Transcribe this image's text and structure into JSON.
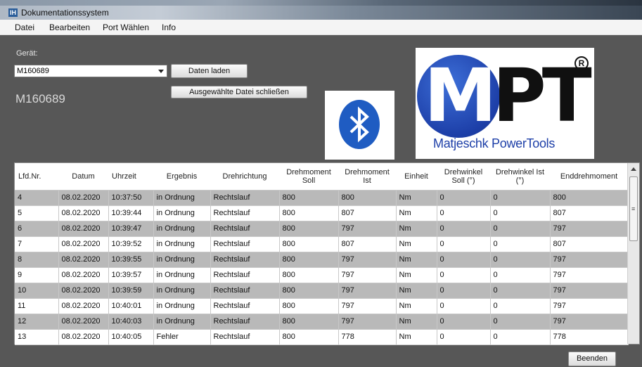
{
  "window": {
    "title": "Dokumentationssystem",
    "icon_text": "IH"
  },
  "menu": [
    "Datei",
    "Bearbeiten",
    "Port Wählen",
    "Info"
  ],
  "device": {
    "label": "Gerät:",
    "selected": "M160689",
    "display": "M160689"
  },
  "buttons": {
    "load": "Daten laden",
    "close_file": "Ausgewählte Datei schließen",
    "quit": "Beenden"
  },
  "logo": {
    "letters_m": "M",
    "letters_rest": "PT",
    "reg": "R",
    "subtitle": "Matjeschk PowerTools"
  },
  "icons": {
    "bluetooth": "bluetooth-icon"
  },
  "colors": {
    "background": "#575757",
    "row_shade": "#b9b9b9",
    "bluetooth": "#1f5cc2"
  },
  "table": {
    "headers": [
      "Lfd.Nr.",
      "Datum",
      "Uhrzeit",
      "Ergebnis",
      "Drehrichtung",
      "Drehmoment\nSoll",
      "Drehmoment\nIst",
      "Einheit",
      "Drehwinkel\nSoll (°)",
      "Drehwinkel Ist\n(°)",
      "Enddrehmoment"
    ],
    "rows": [
      [
        "4",
        "08.02.2020",
        "10:37:50",
        "in Ordnung",
        "Rechtslauf",
        "800",
        "800",
        "Nm",
        "0",
        "0",
        "800"
      ],
      [
        "5",
        "08.02.2020",
        "10:39:44",
        "in Ordnung",
        "Rechtslauf",
        "800",
        "807",
        "Nm",
        "0",
        "0",
        "807"
      ],
      [
        "6",
        "08.02.2020",
        "10:39:47",
        "in Ordnung",
        "Rechtslauf",
        "800",
        "797",
        "Nm",
        "0",
        "0",
        "797"
      ],
      [
        "7",
        "08.02.2020",
        "10:39:52",
        "in Ordnung",
        "Rechtslauf",
        "800",
        "807",
        "Nm",
        "0",
        "0",
        "807"
      ],
      [
        "8",
        "08.02.2020",
        "10:39:55",
        "in Ordnung",
        "Rechtslauf",
        "800",
        "797",
        "Nm",
        "0",
        "0",
        "797"
      ],
      [
        "9",
        "08.02.2020",
        "10:39:57",
        "in Ordnung",
        "Rechtslauf",
        "800",
        "797",
        "Nm",
        "0",
        "0",
        "797"
      ],
      [
        "10",
        "08.02.2020",
        "10:39:59",
        "in Ordnung",
        "Rechtslauf",
        "800",
        "797",
        "Nm",
        "0",
        "0",
        "797"
      ],
      [
        "11",
        "08.02.2020",
        "10:40:01",
        "in Ordnung",
        "Rechtslauf",
        "800",
        "797",
        "Nm",
        "0",
        "0",
        "797"
      ],
      [
        "12",
        "08.02.2020",
        "10:40:03",
        "in Ordnung",
        "Rechtslauf",
        "800",
        "797",
        "Nm",
        "0",
        "0",
        "797"
      ],
      [
        "13",
        "08.02.2020",
        "10:40:05",
        "Fehler",
        "Rechtslauf",
        "800",
        "778",
        "Nm",
        "0",
        "0",
        "778"
      ]
    ]
  }
}
